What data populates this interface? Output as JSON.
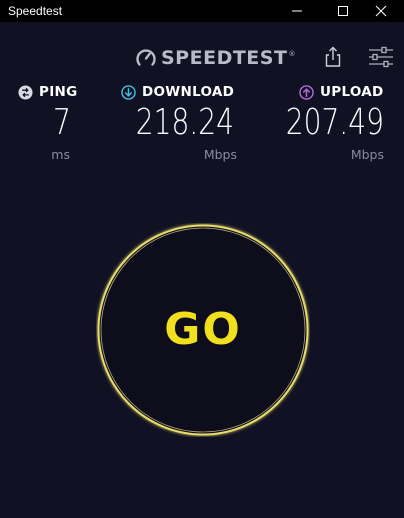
{
  "window": {
    "title": "Speedtest"
  },
  "header": {
    "logo_text": "SPEEDTEST",
    "logo_tm": "®"
  },
  "stats": {
    "ping": {
      "label": "PING",
      "value": "7",
      "unit": "ms"
    },
    "download": {
      "label": "DOWNLOAD",
      "value": "218.24",
      "unit": "Mbps"
    },
    "upload": {
      "label": "UPLOAD",
      "value": "207.49",
      "unit": "Mbps"
    }
  },
  "go_button": {
    "label": "GO"
  },
  "colors": {
    "background": "#111124",
    "titlebar": "#000000",
    "accent_yellow": "#f2df1e",
    "download_teal": "#42c1e3",
    "upload_purple": "#b36bd8",
    "unit_gray": "#8a8aa0"
  },
  "icons": {
    "minimize": "minimize-icon",
    "maximize": "maximize-icon",
    "close": "close-icon",
    "share": "share-icon",
    "settings": "settings-sliders-icon",
    "ping": "ping-icon",
    "download": "download-arrow-icon",
    "upload": "upload-arrow-icon",
    "logo": "speedometer-logo-icon"
  }
}
